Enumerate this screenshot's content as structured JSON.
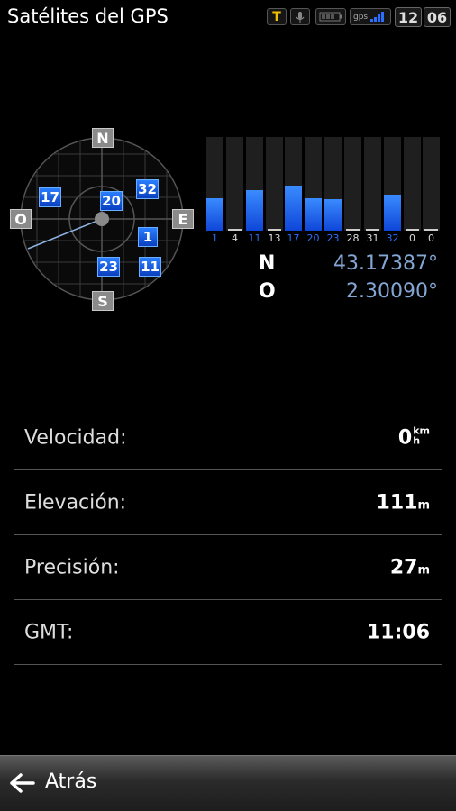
{
  "status_bar": {
    "title": "Satélites del GPS",
    "icons": [
      "t9-text-icon",
      "microphone-icon",
      "battery-icon",
      "gps-signal-icon"
    ],
    "gps_icon_text": "gps",
    "time_hours": "12",
    "time_minutes": "06"
  },
  "compass": {
    "north": "N",
    "south": "S",
    "east": "E",
    "west": "O"
  },
  "sky_satellites": [
    "17",
    "20",
    "32",
    "1",
    "23",
    "11"
  ],
  "signal_bars": [
    {
      "id": "1",
      "level": 0.35,
      "used": true
    },
    {
      "id": "4",
      "level": 0.0,
      "used": false
    },
    {
      "id": "11",
      "level": 0.43,
      "used": true
    },
    {
      "id": "13",
      "level": 0.0,
      "used": false
    },
    {
      "id": "17",
      "level": 0.48,
      "used": true
    },
    {
      "id": "20",
      "level": 0.35,
      "used": true
    },
    {
      "id": "23",
      "level": 0.34,
      "used": true
    },
    {
      "id": "28",
      "level": 0.0,
      "used": false
    },
    {
      "id": "31",
      "level": 0.0,
      "used": false
    },
    {
      "id": "32",
      "level": 0.38,
      "used": true
    },
    {
      "id": "0",
      "level": 0.0,
      "used": false
    },
    {
      "id": "0",
      "level": 0.0,
      "used": false
    }
  ],
  "colors": {
    "used_satellite": "#2a6fff",
    "unused_label": "#dddddd",
    "coordinate": "#84a6d4"
  },
  "coordinates": {
    "lat_dir": "N",
    "lat_value": "43.17387°",
    "lon_dir": "O",
    "lon_value": "2.30090°"
  },
  "info": {
    "speed_label": "Velocidad:",
    "speed_value": "0",
    "speed_unit_top": "km",
    "speed_unit_bottom": "h",
    "elevation_label": "Elevación:",
    "elevation_value": "111",
    "elevation_unit": "m",
    "precision_label": "Precisión:",
    "precision_value": "27",
    "precision_unit": "m",
    "gmt_label": "GMT:",
    "gmt_value": "11:06"
  },
  "bottom_bar": {
    "back_label": "Atrás"
  }
}
